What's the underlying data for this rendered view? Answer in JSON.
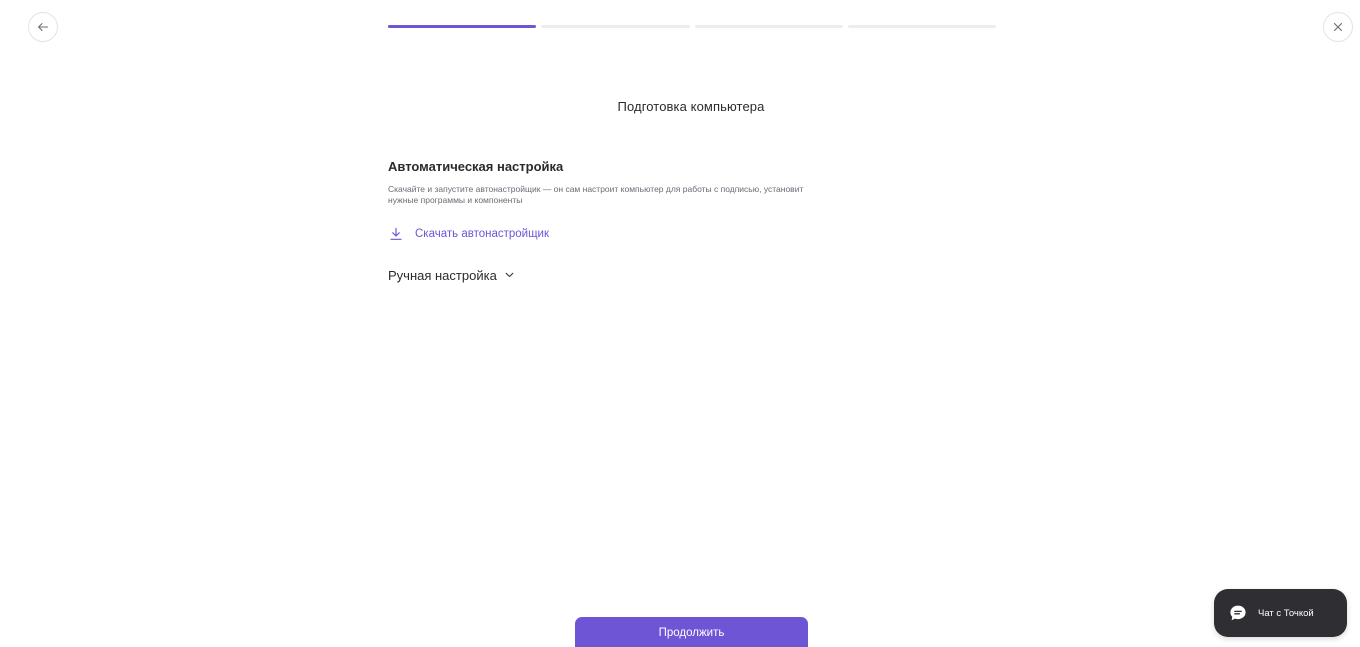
{
  "header": {
    "back_icon": "arrow-left-icon",
    "close_icon": "close-icon",
    "progress": {
      "total_steps": 4,
      "current_step": 1
    }
  },
  "main": {
    "title": "Подготовка компьютера",
    "auto_setup": {
      "title": "Автоматическая настройка",
      "description": "Скачайте и запустите автонастройщик — он сам настроит компьютер для работы с подписью, установит нужные программы и компоненты",
      "download_label": "Скачать автонастройщик",
      "download_icon": "download-icon"
    },
    "manual_setup": {
      "label": "Ручная настройка",
      "icon": "chevron-down-icon"
    }
  },
  "footer": {
    "continue_label": "Продолжить"
  },
  "chat": {
    "label": "Чат с Точкой",
    "icon": "chat-bubble-icon"
  },
  "colors": {
    "accent": "#6e55d6",
    "chat_bg": "#2f2f33",
    "text": "#2b2b2b",
    "muted": "#6b6b75"
  }
}
